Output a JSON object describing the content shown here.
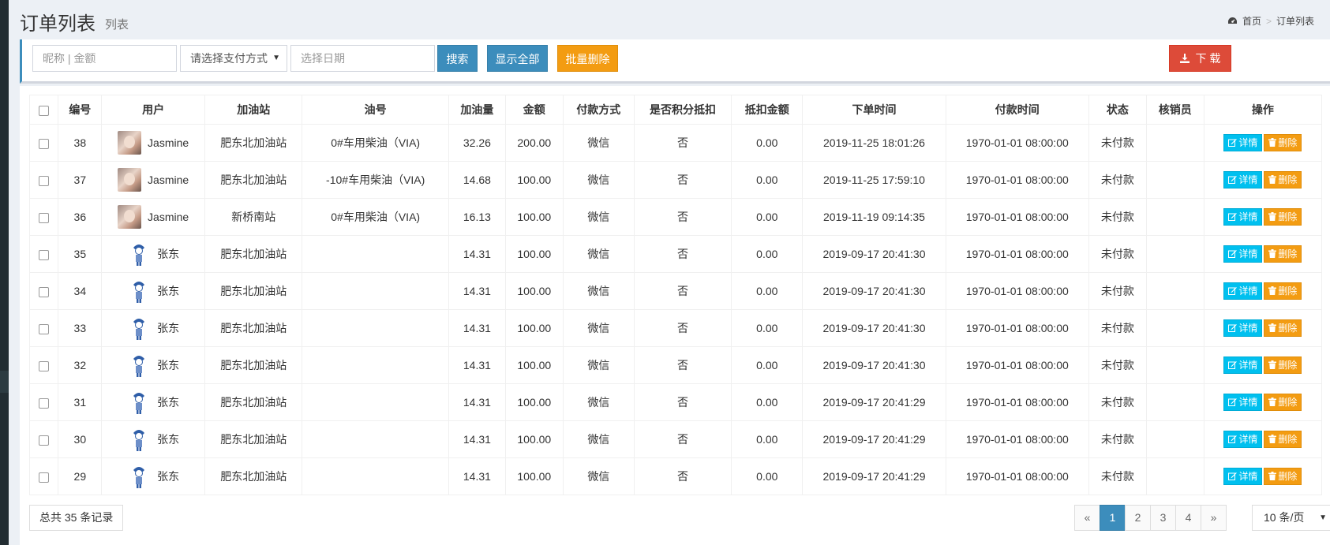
{
  "header": {
    "title": "订单列表",
    "subtitle": "列表",
    "breadcrumb": {
      "home": "首页",
      "sep": ">",
      "current": "订单列表"
    }
  },
  "toolbar": {
    "search_placeholder": "昵称 | 金额",
    "pay_method_select": "请选择支付方式",
    "date_placeholder": "选择日期",
    "search_label": "搜索",
    "show_all_label": "显示全部",
    "batch_delete_label": "批量删除",
    "download_label": "下 载"
  },
  "table": {
    "columns": [
      "编号",
      "用户",
      "加油站",
      "油号",
      "加油量",
      "金额",
      "付款方式",
      "是否积分抵扣",
      "抵扣金额",
      "下单时间",
      "付款时间",
      "状态",
      "核销员",
      "操作"
    ],
    "rows": [
      {
        "id": "38",
        "user": "Jasmine",
        "avatar": "photo",
        "station": "肥东北加油站",
        "oil": "0#车用柴油（VIA)",
        "volume": "32.26",
        "amount": "200.00",
        "pay": "微信",
        "points": "否",
        "deduct": "0.00",
        "order_time": "2019-11-25 18:01:26",
        "pay_time": "1970-01-01 08:00:00",
        "status": "未付款",
        "verifier": ""
      },
      {
        "id": "37",
        "user": "Jasmine",
        "avatar": "photo",
        "station": "肥东北加油站",
        "oil": "-10#车用柴油（VIA)",
        "volume": "14.68",
        "amount": "100.00",
        "pay": "微信",
        "points": "否",
        "deduct": "0.00",
        "order_time": "2019-11-25 17:59:10",
        "pay_time": "1970-01-01 08:00:00",
        "status": "未付款",
        "verifier": ""
      },
      {
        "id": "36",
        "user": "Jasmine",
        "avatar": "photo",
        "station": "新桥南站",
        "oil": "0#车用柴油（VIA)",
        "volume": "16.13",
        "amount": "100.00",
        "pay": "微信",
        "points": "否",
        "deduct": "0.00",
        "order_time": "2019-11-19 09:14:35",
        "pay_time": "1970-01-01 08:00:00",
        "status": "未付款",
        "verifier": ""
      },
      {
        "id": "35",
        "user": "张东",
        "avatar": "icon",
        "station": "肥东北加油站",
        "oil": "",
        "volume": "14.31",
        "amount": "100.00",
        "pay": "微信",
        "points": "否",
        "deduct": "0.00",
        "order_time": "2019-09-17 20:41:30",
        "pay_time": "1970-01-01 08:00:00",
        "status": "未付款",
        "verifier": ""
      },
      {
        "id": "34",
        "user": "张东",
        "avatar": "icon",
        "station": "肥东北加油站",
        "oil": "",
        "volume": "14.31",
        "amount": "100.00",
        "pay": "微信",
        "points": "否",
        "deduct": "0.00",
        "order_time": "2019-09-17 20:41:30",
        "pay_time": "1970-01-01 08:00:00",
        "status": "未付款",
        "verifier": ""
      },
      {
        "id": "33",
        "user": "张东",
        "avatar": "icon",
        "station": "肥东北加油站",
        "oil": "",
        "volume": "14.31",
        "amount": "100.00",
        "pay": "微信",
        "points": "否",
        "deduct": "0.00",
        "order_time": "2019-09-17 20:41:30",
        "pay_time": "1970-01-01 08:00:00",
        "status": "未付款",
        "verifier": ""
      },
      {
        "id": "32",
        "user": "张东",
        "avatar": "icon",
        "station": "肥东北加油站",
        "oil": "",
        "volume": "14.31",
        "amount": "100.00",
        "pay": "微信",
        "points": "否",
        "deduct": "0.00",
        "order_time": "2019-09-17 20:41:30",
        "pay_time": "1970-01-01 08:00:00",
        "status": "未付款",
        "verifier": ""
      },
      {
        "id": "31",
        "user": "张东",
        "avatar": "icon",
        "station": "肥东北加油站",
        "oil": "",
        "volume": "14.31",
        "amount": "100.00",
        "pay": "微信",
        "points": "否",
        "deduct": "0.00",
        "order_time": "2019-09-17 20:41:29",
        "pay_time": "1970-01-01 08:00:00",
        "status": "未付款",
        "verifier": ""
      },
      {
        "id": "30",
        "user": "张东",
        "avatar": "icon",
        "station": "肥东北加油站",
        "oil": "",
        "volume": "14.31",
        "amount": "100.00",
        "pay": "微信",
        "points": "否",
        "deduct": "0.00",
        "order_time": "2019-09-17 20:41:29",
        "pay_time": "1970-01-01 08:00:00",
        "status": "未付款",
        "verifier": ""
      },
      {
        "id": "29",
        "user": "张东",
        "avatar": "icon",
        "station": "肥东北加油站",
        "oil": "",
        "volume": "14.31",
        "amount": "100.00",
        "pay": "微信",
        "points": "否",
        "deduct": "0.00",
        "order_time": "2019-09-17 20:41:29",
        "pay_time": "1970-01-01 08:00:00",
        "status": "未付款",
        "verifier": ""
      }
    ],
    "detail_label": "详情",
    "delete_label": "删除"
  },
  "footer": {
    "total_text": "总共 35 条记录",
    "pages": [
      "«",
      "1",
      "2",
      "3",
      "4",
      "»"
    ],
    "active_page": "1",
    "per_page": "10 条/页"
  },
  "colors": {
    "primary": "#3c8dbc",
    "warning": "#f39c12",
    "danger": "#dd4b39",
    "info": "#00c0ef"
  }
}
